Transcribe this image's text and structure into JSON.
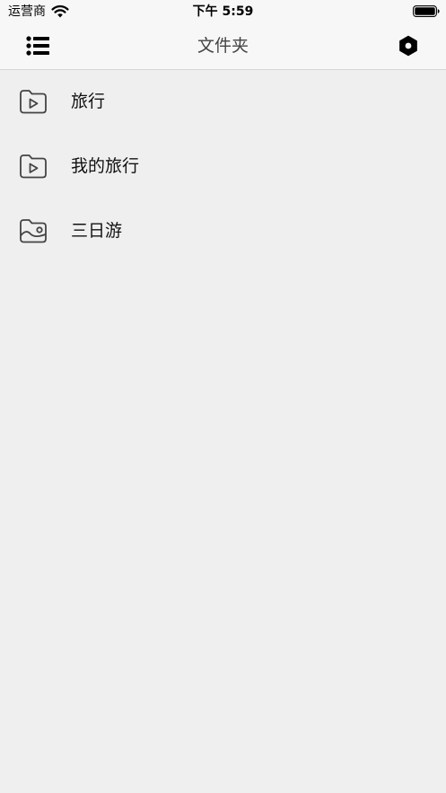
{
  "status_bar": {
    "carrier": "运营商",
    "time": "下午 5:59",
    "wifi_icon": "wifi-icon",
    "battery_icon": "battery-full-icon"
  },
  "nav": {
    "title": "文件夹",
    "left_icon": "list-icon",
    "right_icon": "settings-hexagon-icon"
  },
  "folders": [
    {
      "label": "旅行",
      "icon": "video-folder-icon"
    },
    {
      "label": "我的旅行",
      "icon": "video-folder-icon"
    },
    {
      "label": "三日游",
      "icon": "photo-folder-icon"
    }
  ],
  "colors": {
    "background": "#efefef",
    "bar_background": "#f7f7f7",
    "title_text": "#444444",
    "icon_stroke": "#444444"
  }
}
